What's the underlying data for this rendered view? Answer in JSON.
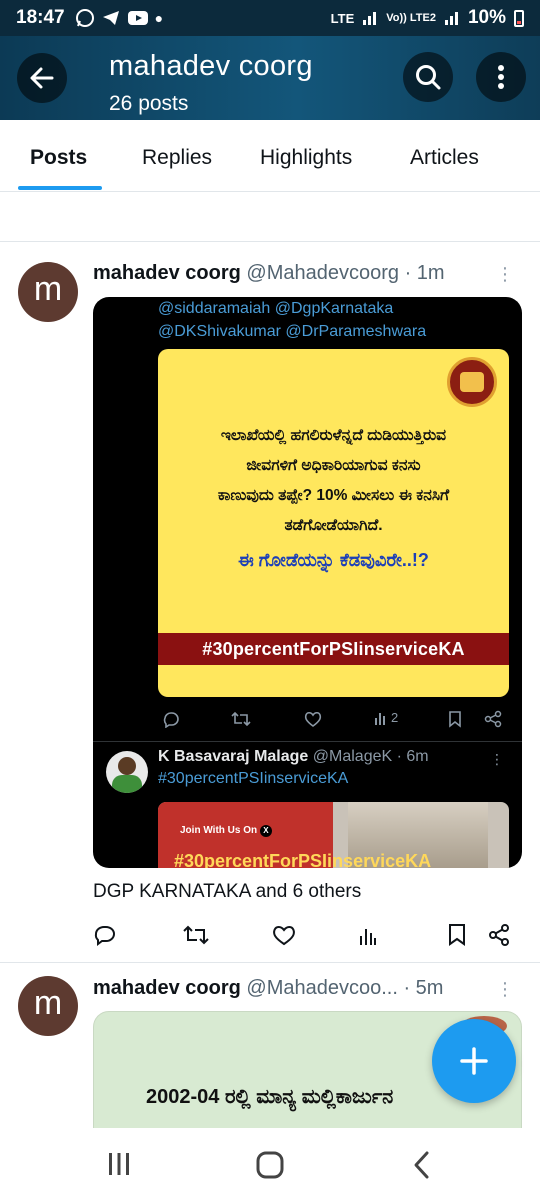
{
  "status_bar": {
    "time": "18:47",
    "network_label_1": "LTE",
    "network_label_2": "Vo)) LTE2",
    "battery": "10%"
  },
  "header": {
    "title": "mahadev coorg",
    "subtitle": "26 posts",
    "back_icon": "arrow-left-icon",
    "search_icon": "search-icon",
    "more_icon": "more-vertical-icon"
  },
  "tabs": [
    {
      "label": "Posts",
      "active": true
    },
    {
      "label": "Replies",
      "active": false
    },
    {
      "label": "Highlights",
      "active": false
    },
    {
      "label": "Articles",
      "active": false
    }
  ],
  "tweets": [
    {
      "avatar_letter": "m",
      "name": "mahadev coorg",
      "handle": "@Mahadevcoorg",
      "time": "· 1m",
      "media": {
        "mentions_line1": "@siddaramaiah @DgpKarnataka",
        "mentions_line2": "@DKShivakumar @DrParameshwara",
        "poster_line1": "ಇಲಾಖೆಯಲ್ಲಿ ಹಗಲಿರುಳೆನ್ನದೆ ದುಡಿಯುತ್ತಿರುವ",
        "poster_line2": "ಜೀವಗಳಿಗೆ ಅಧಿಕಾರಿಯಾಗುವ ಕನಸು",
        "poster_line3": "ಕಾಣುವುದು ತಪ್ಪೇ? 10% ಮೀಸಲು ಈ ಕನಸಿಗೆ",
        "poster_line4": "ತಡೆಗೋಡೆಯಾಗಿದೆ.",
        "poster_question": "ಈ ಗೋಡೆಯನ್ನು ಕೆಡವುವಿರೇ..!?",
        "poster_hashtag": "#30percentForPSIinserviceKA",
        "inner_views": "2",
        "quote": {
          "name": "K Basavaraj Malage",
          "handle": "@MalageK",
          "time": "· 6m",
          "hashtag": "#30percentPSIinserviceKA",
          "image_caption": "Join With Us On",
          "image_big": "#30percentForPSIinserviceKA"
        }
      },
      "social_context": "DGP KARNATAKA and 6 others"
    },
    {
      "avatar_letter": "m",
      "name": "mahadev coorg",
      "handle": "@Mahadevcoo...",
      "time": "· 5m",
      "media_text": "2002-04 ರಲ್ಲಿ ಮಾನ್ಯ ಮಲ್ಲಿಕಾರ್ಜುನ"
    }
  ],
  "fab_icon": "plus-icon",
  "nav": {
    "recents_icon": "recents-icon",
    "home_icon": "home-icon",
    "back_icon": "back-chevron-icon"
  },
  "colors": {
    "accent": "#1d9bf0",
    "header_bg": "#0c3a55",
    "avatar_bg": "#5d3a30",
    "poster_yellow": "#ffe75d",
    "poster_band": "#8a1111"
  }
}
